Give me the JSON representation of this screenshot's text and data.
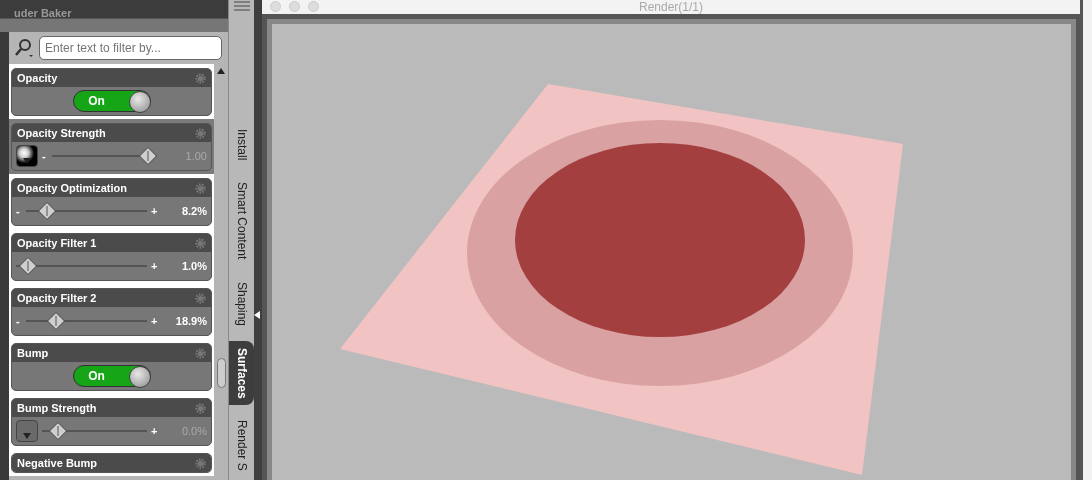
{
  "panel": {
    "title": "uder Baker",
    "filter": {
      "placeholder": "Enter text to filter by..."
    },
    "properties": [
      {
        "kind": "toggle",
        "label": "Opacity",
        "highlighted": true,
        "on": true,
        "state_text": "On"
      },
      {
        "kind": "slider",
        "label": "Opacity Strength",
        "highlighted": false,
        "has_map": true,
        "map_set": true,
        "level": 1.0,
        "modified": false,
        "value": "1.00",
        "minus": "-"
      },
      {
        "kind": "slider",
        "label": "Opacity Optimization",
        "highlighted": true,
        "has_map": false,
        "level": 0.12,
        "modified": true,
        "value": "8.2%",
        "minus": "-",
        "plus": "+"
      },
      {
        "kind": "slider",
        "label": "Opacity Filter 1",
        "highlighted": true,
        "has_map": false,
        "level": 0.03,
        "modified": true,
        "value": "1.0%",
        "plus": "+"
      },
      {
        "kind": "slider",
        "label": "Opacity Filter 2",
        "highlighted": true,
        "has_map": false,
        "level": 0.2,
        "modified": true,
        "value": "18.9%",
        "minus": "-",
        "plus": "+"
      },
      {
        "kind": "toggle",
        "label": "Bump",
        "highlighted": true,
        "on": true,
        "state_text": "On"
      },
      {
        "kind": "slider",
        "label": "Bump Strength",
        "highlighted": true,
        "has_map": true,
        "map_set": false,
        "level": 0.08,
        "modified": false,
        "value": "0.0%",
        "plus": "+"
      },
      {
        "kind": "header",
        "label": "Negative Bump",
        "highlighted": true
      }
    ]
  },
  "side_tabs": [
    {
      "label": "Install",
      "selected": false
    },
    {
      "label": "Smart Content",
      "selected": false
    },
    {
      "label": "Shaping",
      "selected": false
    },
    {
      "label": "Surfaces",
      "selected": true
    },
    {
      "label": "Render S",
      "selected": false
    }
  ],
  "render_window": {
    "title": "Render(1/1)"
  }
}
